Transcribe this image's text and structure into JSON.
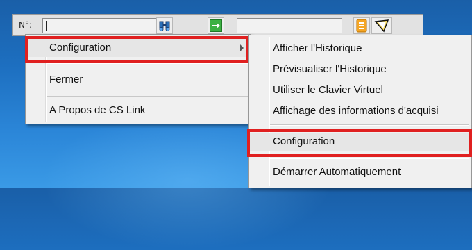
{
  "toolbar": {
    "number_label": "N°:",
    "number_value": "",
    "field2_value": "",
    "icons": [
      "binoculars-icon",
      "green-arrow-icon",
      "orange-notepad-icon",
      "yellow-cone-icon"
    ]
  },
  "menu_main": {
    "items": [
      {
        "label": "Configuration",
        "has_submenu": true,
        "highlighted": true
      },
      {
        "label": "Fermer"
      },
      {
        "label": "A Propos de CS Link"
      }
    ]
  },
  "menu_sub": {
    "items": [
      {
        "label": "Afficher l'Historique"
      },
      {
        "label": "Prévisualiser l'Historique"
      },
      {
        "label": "Utiliser le Clavier Virtuel"
      },
      {
        "label": "Affichage des informations d'acquisi"
      },
      {
        "label": "Configuration",
        "highlighted": true
      },
      {
        "label": "Démarrer Automatiquement"
      }
    ]
  },
  "colors": {
    "highlight_box": "#e02020",
    "desktop": "#1d6fc0",
    "menu_bg": "#f0f0f0"
  }
}
